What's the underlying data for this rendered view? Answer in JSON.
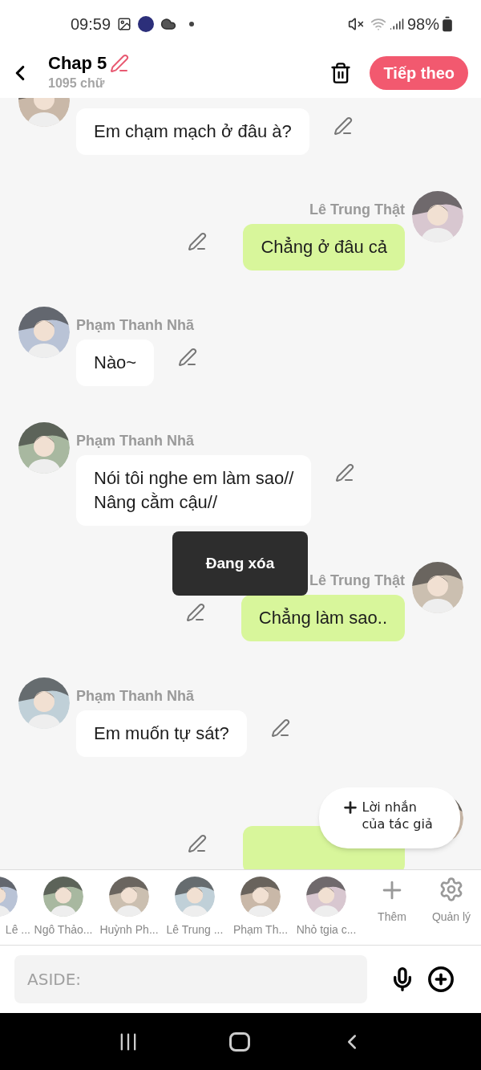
{
  "status_bar": {
    "time": "09:59",
    "battery": "98%"
  },
  "header": {
    "title": "Chap 5",
    "word_count": "1095 chữ",
    "next_button": "Tiếp theo"
  },
  "messages": [
    {
      "kind": "incoming",
      "text": "Em chạm mạch ở đâu à?"
    },
    {
      "kind": "outgoing",
      "sender": "Lê Trung Thật",
      "text": "Chẳng ở đâu cả"
    },
    {
      "kind": "incoming",
      "sender": "Phạm Thanh Nhã",
      "text": "Nào~"
    },
    {
      "kind": "incoming",
      "sender": "Phạm Thanh Nhã",
      "text": "Nói tôi nghe em làm sao//\nNâng cằm cậu//"
    },
    {
      "kind": "outgoing",
      "sender": "Lê Trung Thật",
      "text": "Chẳng làm sao.."
    },
    {
      "kind": "incoming",
      "sender": "Phạm Thanh Nhã",
      "text": "Em muốn tự sát?"
    },
    {
      "kind": "outgoing"
    }
  ],
  "toast": "Đang xóa",
  "author_note_button": "Lời nhắn của tác giả",
  "characters": [
    {
      "name": "Lê ..."
    },
    {
      "name": "Ngô Thảo..."
    },
    {
      "name": "Huỳnh Ph..."
    },
    {
      "name": "Lê Trung ..."
    },
    {
      "name": "Phạm Th..."
    },
    {
      "name": "Nhỏ tgia c..."
    }
  ],
  "add_button": "Thêm",
  "manage_button": "Quản lý",
  "input": {
    "placeholder": "ASIDE:"
  }
}
